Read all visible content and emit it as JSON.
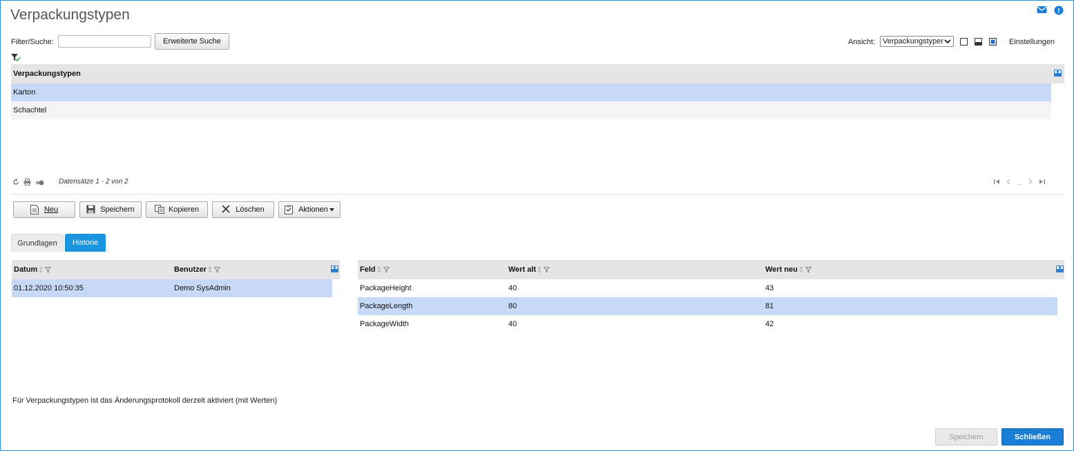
{
  "header": {
    "title": "Verpackungstypen",
    "icons": [
      "mail-icon",
      "help-icon"
    ]
  },
  "filter": {
    "label": "Filter/Suche:",
    "value": "",
    "extended_search_label": "Erweiterte Suche"
  },
  "view": {
    "label": "Ansicht:",
    "selected": "Verpackungstypen",
    "settings_label": "Einstellungen"
  },
  "main_grid": {
    "column": "Verpackungstypen",
    "rows": [
      "Karton",
      "Schachtel"
    ],
    "selected_index": 0,
    "records_text": "Datensätze 1 - 2 von 2",
    "pager_ellipsis": "..."
  },
  "toolbar": {
    "new_label": "Neu",
    "save_label": "Speichern",
    "copy_label": "Kopieren",
    "delete_label": "Löschen",
    "actions_label": "Aktionen"
  },
  "tabs": [
    {
      "label": "Grundlagen",
      "active": false
    },
    {
      "label": "Historie",
      "active": true
    }
  ],
  "history": {
    "columns": [
      "Datum",
      "Benutzer"
    ],
    "rows": [
      {
        "date": "01.12.2020 10:50:35",
        "user": "Demo SysAdmin"
      }
    ]
  },
  "changes": {
    "columns": [
      "Feld",
      "Wert alt",
      "Wert neu"
    ],
    "rows": [
      {
        "field": "PackageHeight",
        "old": "40",
        "new": "43"
      },
      {
        "field": "PackageLength",
        "old": "80",
        "new": "81"
      },
      {
        "field": "PackageWidth",
        "old": "40",
        "new": "42"
      }
    ],
    "selected_index": 1
  },
  "status_text": "Für Verpackungstypen ist das Änderungsprotokoll derzeit aktiviert (mit Werten)",
  "footer": {
    "save_label": "Speichern",
    "close_label": "Schließen"
  },
  "colors": {
    "accent": "#1a94df",
    "selected_row": "#c6d9f7",
    "header_bg": "#e5e5e5"
  }
}
